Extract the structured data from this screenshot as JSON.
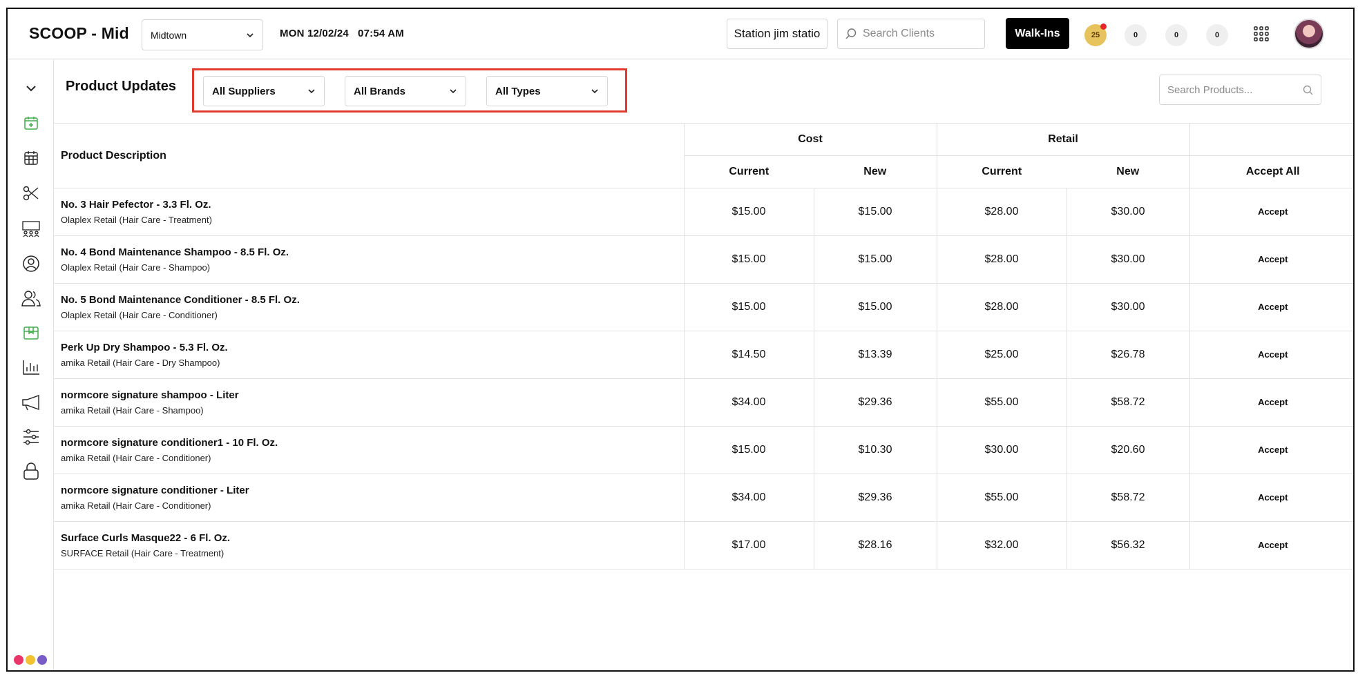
{
  "header": {
    "app_title": "SCOOP - Mid",
    "location": "Midtown",
    "datetime": "MON 12/02/24   07:54 AM",
    "station_label": "Station jim statio",
    "client_search_placeholder": "Search Clients",
    "walkins_label": "Walk-Ins",
    "badges": [
      "25",
      "0",
      "0",
      "0"
    ]
  },
  "page": {
    "title": "Product Updates",
    "filters": {
      "suppliers": "All Suppliers",
      "brands": "All Brands",
      "types": "All Types"
    },
    "search_placeholder": "Search Products..."
  },
  "table": {
    "desc_header": "Product Description",
    "cost_header": "Cost",
    "retail_header": "Retail",
    "current_label": "Current",
    "new_label": "New",
    "accept_all_label": "Accept All",
    "accept_label": "Accept",
    "rows": [
      {
        "name": "No. 3 Hair Pefector - 3.3 Fl. Oz.",
        "sub": "Olaplex Retail (Hair Care - Treatment)",
        "cost_current": "$15.00",
        "cost_new": "$15.00",
        "retail_current": "$28.00",
        "retail_new": "$30.00"
      },
      {
        "name": "No. 4 Bond Maintenance Shampoo - 8.5 Fl. Oz.",
        "sub": "Olaplex Retail (Hair Care - Shampoo)",
        "cost_current": "$15.00",
        "cost_new": "$15.00",
        "retail_current": "$28.00",
        "retail_new": "$30.00"
      },
      {
        "name": "No. 5 Bond Maintenance Conditioner - 8.5 Fl. Oz.",
        "sub": "Olaplex Retail (Hair Care - Conditioner)",
        "cost_current": "$15.00",
        "cost_new": "$15.00",
        "retail_current": "$28.00",
        "retail_new": "$30.00"
      },
      {
        "name": "Perk Up Dry Shampoo - 5.3 Fl. Oz.",
        "sub": "amika Retail (Hair Care - Dry Shampoo)",
        "cost_current": "$14.50",
        "cost_new": "$13.39",
        "retail_current": "$25.00",
        "retail_new": "$26.78"
      },
      {
        "name": "normcore signature shampoo - Liter",
        "sub": "amika Retail (Hair Care - Shampoo)",
        "cost_current": "$34.00",
        "cost_new": "$29.36",
        "retail_current": "$55.00",
        "retail_new": "$58.72"
      },
      {
        "name": "normcore signature conditioner1 - 10 Fl. Oz.",
        "sub": "amika Retail (Hair Care - Conditioner)",
        "cost_current": "$15.00",
        "cost_new": "$10.30",
        "retail_current": "$30.00",
        "retail_new": "$20.60"
      },
      {
        "name": "normcore signature conditioner - Liter",
        "sub": "amika Retail (Hair Care - Conditioner)",
        "cost_current": "$34.00",
        "cost_new": "$29.36",
        "retail_current": "$55.00",
        "retail_new": "$58.72"
      },
      {
        "name": "Surface Curls Masque22 - 6 Fl. Oz.",
        "sub": "SURFACE Retail (Hair Care - Treatment)",
        "cost_current": "$17.00",
        "cost_new": "$28.16",
        "retail_current": "$32.00",
        "retail_new": "$56.32"
      }
    ]
  },
  "sidebar": {
    "icons": [
      "chevron-down-icon",
      "calendar-add-icon",
      "calendar-grid-icon",
      "scissors-icon",
      "classroom-icon",
      "user-circle-icon",
      "users-icon",
      "box-icon",
      "bar-chart-icon",
      "megaphone-icon",
      "sliders-icon",
      "lock-icon"
    ]
  },
  "colors": {
    "accent_green": "#3fae49",
    "highlight_red": "#e13a2e",
    "badge_yellow": "#e6c35c",
    "dot_pink": "#e8366a",
    "dot_yellow": "#f2c230",
    "dot_purple": "#7a5cc8"
  }
}
